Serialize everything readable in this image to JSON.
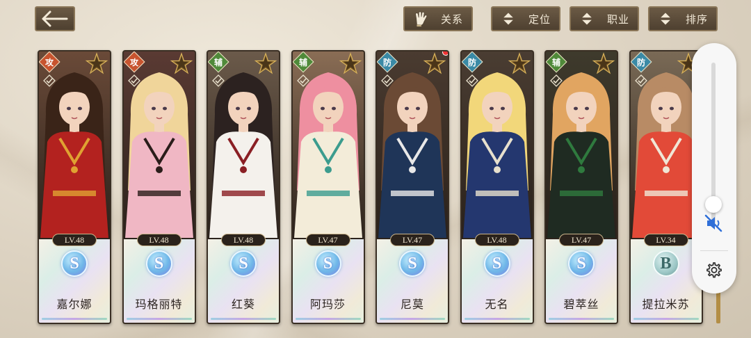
{
  "back_button": {
    "icon": "arrow-left-icon"
  },
  "toolbar": [
    {
      "label": "关系",
      "icon": "glove-icon"
    },
    {
      "label": "定位",
      "icon": "sort-arrows-icon"
    },
    {
      "label": "职业",
      "icon": "sort-arrows-icon"
    },
    {
      "label": "排序",
      "icon": "sort-arrows-icon"
    }
  ],
  "characters": [
    {
      "role": "攻",
      "role_type": "atk",
      "level": "LV.48",
      "rank": "S",
      "name": "嘉尔娜",
      "hair": "#3a2418",
      "outfit": "#b3221f",
      "accent": "#e0a232",
      "bg": "#6a4a38",
      "notify": false
    },
    {
      "role": "攻",
      "role_type": "atk",
      "level": "LV.48",
      "rank": "S",
      "name": "玛格丽特",
      "hair": "#f0d59a",
      "outfit": "#f0b7c4",
      "accent": "#2a1d1a",
      "bg": "#5a3a33",
      "notify": false
    },
    {
      "role": "辅",
      "role_type": "sup",
      "level": "LV.48",
      "rank": "S",
      "name": "红葵",
      "hair": "#2c2220",
      "outfit": "#f4f1ec",
      "accent": "#8a1f24",
      "bg": "#6b5a4a",
      "notify": false
    },
    {
      "role": "辅",
      "role_type": "sup",
      "level": "LV.47",
      "rank": "S",
      "name": "阿玛莎",
      "hair": "#ee8fa0",
      "outfit": "#f3ecd9",
      "accent": "#3b9c8e",
      "bg": "#8a6d55",
      "notify": false
    },
    {
      "role": "防",
      "role_type": "def",
      "level": "LV.47",
      "rank": "S",
      "name": "尼莫",
      "hair": "#6b4a35",
      "outfit": "#1f3558",
      "accent": "#e8e8e8",
      "bg": "#4a3b30",
      "notify": true
    },
    {
      "role": "防",
      "role_type": "def",
      "level": "LV.48",
      "rank": "S",
      "name": "无名",
      "hair": "#f2d77a",
      "outfit": "#24376f",
      "accent": "#e7e0cd",
      "bg": "#4a3d32",
      "notify": false
    },
    {
      "role": "辅",
      "role_type": "sup",
      "level": "LV.47",
      "rank": "S",
      "name": "碧萃丝",
      "hair": "#e1a561",
      "outfit": "#1f2b22",
      "accent": "#2f7a3e",
      "bg": "#3e3a2c",
      "notify": false
    },
    {
      "role": "防",
      "role_type": "def",
      "level": "LV.34",
      "rank": "B",
      "name": "提拉米苏",
      "hair": "#b88b65",
      "outfit": "#e24a38",
      "accent": "#f0e6d6",
      "bg": "#7a6a56",
      "notify": false
    }
  ],
  "volume": {
    "level_fraction": 0.06,
    "muted": true,
    "mute_icon": "speaker-muted-icon",
    "settings_icon": "gear-icon"
  }
}
